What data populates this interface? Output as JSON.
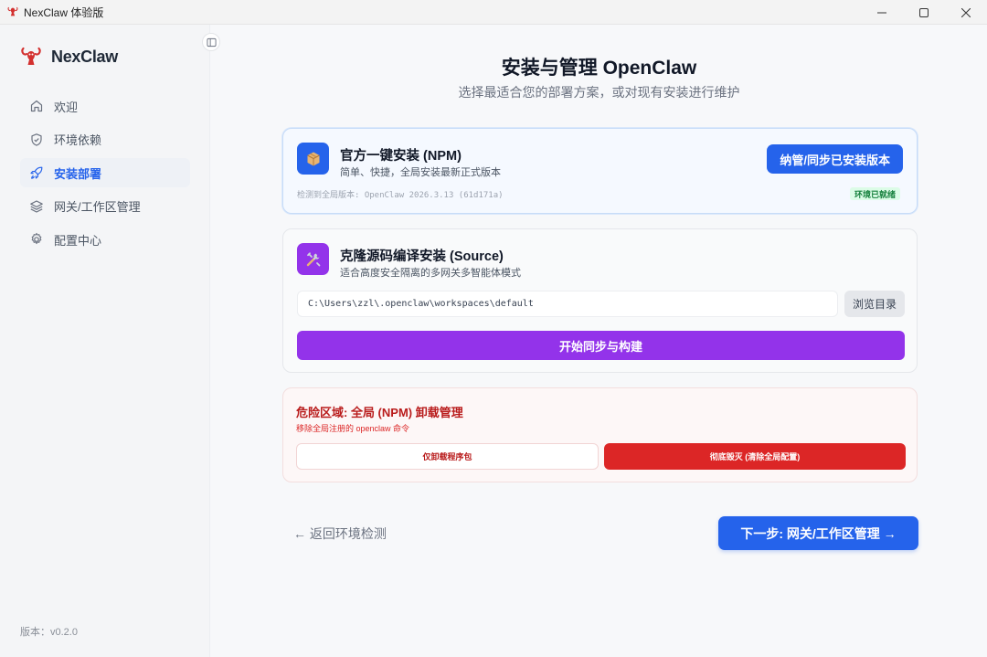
{
  "window": {
    "title": "NexClaw 体验版",
    "app_icon": "lobster-icon"
  },
  "sidebar": {
    "brand": "NexClaw",
    "items": [
      {
        "label": "欢迎",
        "icon": "home-icon",
        "active": false
      },
      {
        "label": "环境依赖",
        "icon": "shield-check-icon",
        "active": false
      },
      {
        "label": "安装部署",
        "icon": "rocket-icon",
        "active": true
      },
      {
        "label": "网关/工作区管理",
        "icon": "layers-icon",
        "active": false
      },
      {
        "label": "配置中心",
        "icon": "gear-icon",
        "active": false
      }
    ],
    "version": "版本：v0.2.0"
  },
  "main": {
    "title": "安装与管理 OpenClaw",
    "subtitle": "选择最适合您的部署方案，或对现有安装进行维护",
    "npm_card": {
      "icon": "package-icon",
      "title": "官方一键安装 (NPM)",
      "desc": "简单、快捷，全局安装最新正式版本",
      "button": "纳管/同步已安装版本",
      "detected": "检测到全局版本: OpenClaw 2026.3.13 (61d171a)",
      "badge": "环境已就绪"
    },
    "source_card": {
      "icon": "tools-icon",
      "title": "克隆源码编译安装 (Source)",
      "desc": "适合高度安全隔离的多网关多智能体模式",
      "path": "C:\\Users\\zzl\\.openclaw\\workspaces\\default",
      "browse": "浏览目录",
      "build": "开始同步与构建"
    },
    "danger_card": {
      "title": "危险区域: 全局 (NPM) 卸载管理",
      "desc": "移除全局注册的 openclaw 命令",
      "uninstall": "仅卸载程序包",
      "destroy": "彻底毁灭 (清除全局配置)"
    },
    "back": "← 返回环境检测",
    "next": "下一步: 网关/工作区管理 →"
  },
  "colors": {
    "accent": "#2563eb",
    "purple": "#9333ea",
    "danger": "#dc2626",
    "success": "#15803d"
  }
}
